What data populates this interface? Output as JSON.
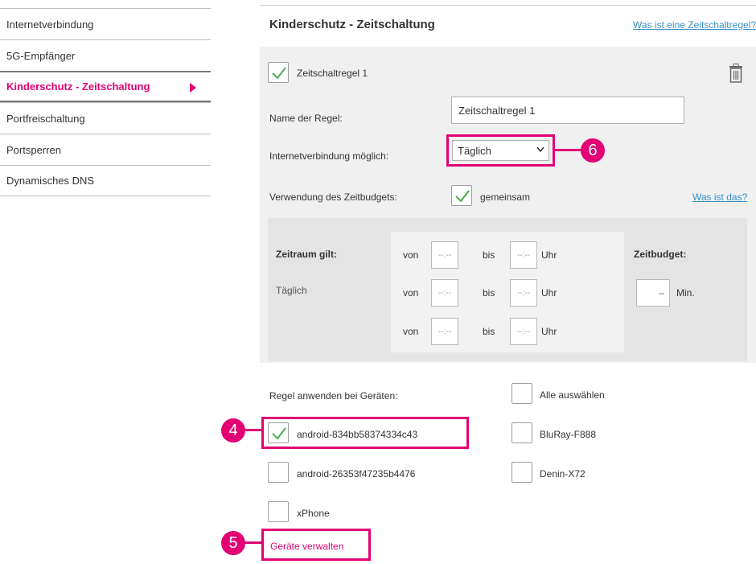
{
  "sidebar": {
    "items": [
      {
        "label": "Internetverbindung"
      },
      {
        "label": "5G-Empfänger"
      },
      {
        "label": "Kinderschutz - Zeitschaltung"
      },
      {
        "label": "Portfreischaltung"
      },
      {
        "label": "Portsperren"
      },
      {
        "label": "Dynamisches DNS"
      }
    ],
    "active_index": 2
  },
  "header": {
    "title": "Kinderschutz - Zeitschaltung",
    "help_link": "Was ist eine Zeitschaltregel?"
  },
  "rule": {
    "title": "Zeitschaltregel 1",
    "enabled": true,
    "name_label": "Name der Regel:",
    "name_value": "Zeitschaltregel 1",
    "connection_label": "Internetverbindung möglich:",
    "connection_value": "Täglich",
    "budget_label": "Verwendung des Zeitbudgets:",
    "budget_checked": true,
    "budget_option": "gemeinsam",
    "budget_help": "Was ist das?"
  },
  "schedule": {
    "period_label": "Zeitraum gilt:",
    "period_value": "Täglich",
    "from_label": "von",
    "to_label": "bis",
    "unit_label": "Uhr",
    "time_placeholder": "--:--",
    "budget_title": "Zeitbudget:",
    "budget_value": "–",
    "budget_unit": "Min."
  },
  "devices": {
    "label": "Regel anwenden bei Geräten:",
    "select_all": "Alle auswählen",
    "items": [
      {
        "name": "android-834bb58374334c43",
        "checked": true
      },
      {
        "name": "BluRay-F888",
        "checked": false
      },
      {
        "name": "android-26353f47235b4476",
        "checked": false
      },
      {
        "name": "Denin-X72",
        "checked": false
      },
      {
        "name": "xPhone",
        "checked": false
      }
    ],
    "manage_link": "Geräte verwalten"
  },
  "callouts": [
    "4",
    "5",
    "6"
  ],
  "colors": {
    "accent": "#e20074",
    "link": "#3a8fc7",
    "check": "#4caf50"
  }
}
